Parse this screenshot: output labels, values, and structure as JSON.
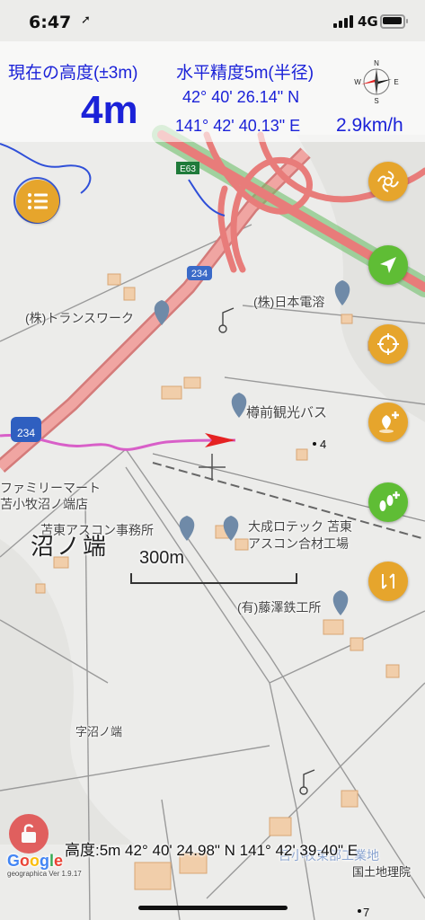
{
  "status": {
    "time": "6:47",
    "network": "4G"
  },
  "hud": {
    "altitude_label": "現在の高度(±3m)",
    "altitude_value": "4m",
    "accuracy_label": "水平精度5m(半径)",
    "latitude": "42° 40' 26.14\" N",
    "longitude": "141° 42' 40.13\" E",
    "speed": "2.9km/h",
    "compass_letters": [
      "N",
      "E",
      "S",
      "W"
    ]
  },
  "map": {
    "labels": {
      "e63": "E63",
      "r234_top": "234",
      "r234_left": "234",
      "transwork": "(株)トランスワーク",
      "nihon_densetsu": "(株)日本電溶",
      "tarumae_bus": "樽前観光バス",
      "family_mart_1": "ファミリーマート",
      "family_mart_2": "苫小牧沼ノ端店",
      "tomato_ascon": "苫東アスコン事務所",
      "taisei_1": "大成ロテック 苫東",
      "taisei_2": "アスコン合材工場",
      "numanohata": "沼ノ端",
      "fujisawa": "(有)藤澤鉄工所",
      "aza_numanohata": "字沼ノ端",
      "point_4": "4",
      "point_7": "7",
      "tomakomai_koritsu": "苫小牧東部工業地"
    },
    "scale": "300m",
    "bottom_info": "高度:5m  42° 40' 24.98\" N 141° 42' 39.40\" E",
    "google": "Google",
    "version": "geographica Ver 1.9.17",
    "attribution": "国土地理院"
  },
  "colors": {
    "accent_blue": "#1b22d8",
    "button_orange": "#e6a52c",
    "button_green": "#5fbd35",
    "track_pink": "#d85fc8",
    "heading_red": "#e52222",
    "expressway": "#e87c7a"
  },
  "icons": {
    "menu": "list-icon",
    "map_style": "swirl-icon",
    "follow": "navigation-arrow-icon",
    "target": "crosshair-icon",
    "add_point": "pin-plus-icon",
    "add_track": "footprints-plus-icon",
    "route": "route-icon",
    "lock": "unlock-icon"
  }
}
